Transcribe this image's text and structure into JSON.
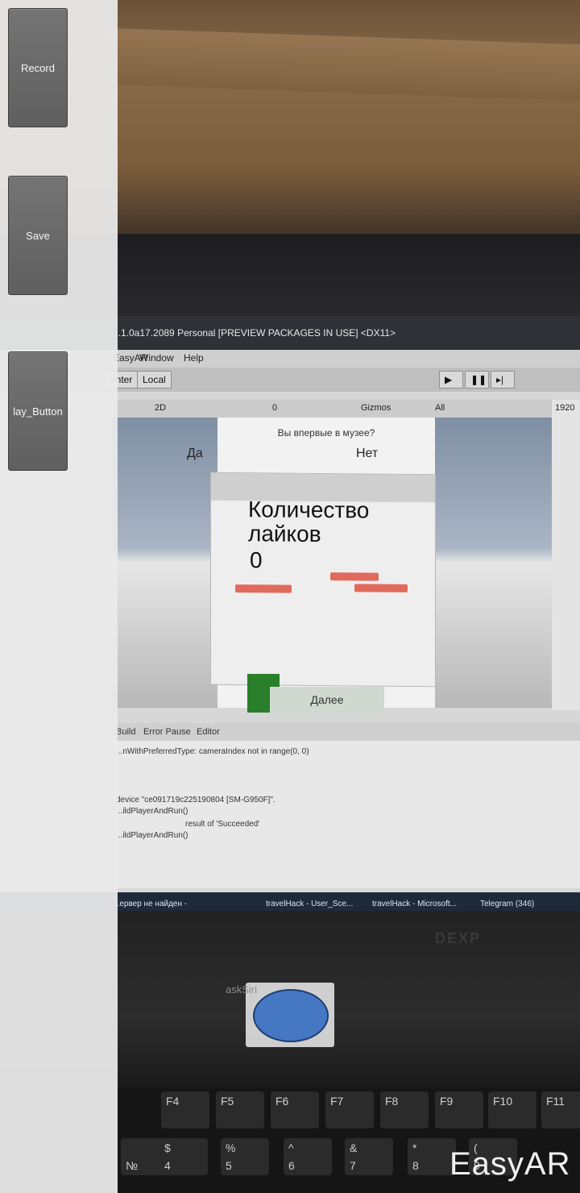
{
  "unity": {
    "title": "...1.0a17.2089 Personal [PREVIEW PACKAGES IN USE] <DX11>",
    "menu": [
      "EasyAR",
      "Window",
      "Help"
    ],
    "toolbar": {
      "center": "enter",
      "local": "Local"
    },
    "scene_toolbar": {
      "mode_2d": "2D",
      "gizmos": "Gizmos",
      "search": "All",
      "count": "0"
    },
    "console_tabs": [
      "Build",
      "Error Pause",
      "Editor"
    ],
    "console_lines": [
      "...nWithPreferredType: cameraIndex not in range(0, 0)",
      "device \"ce091719c225190804 [SM-G950F]\".",
      "...ildPlayerAndRun()",
      "result of 'Succeeded'",
      "...ildPlayerAndRun()"
    ],
    "scene_ui": {
      "question": "Вы впервые в музее?",
      "yes": "Да",
      "no": "Нет"
    },
    "resolution": "1920"
  },
  "taskbar": {
    "items": [
      "...ервер не найден -",
      "travelHack - User_Sce...",
      "travelHack - Microsoft...",
      "Telegram (346)"
    ]
  },
  "laptop": {
    "brand": "DEXP"
  },
  "keyboard": {
    "fkeys": [
      "F4",
      "F5",
      "F6",
      "F7",
      "F8",
      "F9",
      "F10",
      "F11"
    ],
    "row2": [
      "№",
      "$",
      "%",
      "^",
      "&",
      "*",
      "("
    ],
    "row2_nums": [
      "4",
      "5",
      "6",
      "7",
      "8",
      "9"
    ]
  },
  "ar_card": {
    "title": "Количество\nлайков",
    "count": "0",
    "next_button": "Далее"
  },
  "app": {
    "buttons": {
      "record": "Record",
      "save": "Save",
      "play": "lay_Button"
    },
    "siri_label": "askSiri",
    "watermark": "EasyAR"
  },
  "colors": {
    "siri_button": "#4577c2",
    "green_cube": "#2a7f2a",
    "panel": "#eaeaea"
  }
}
